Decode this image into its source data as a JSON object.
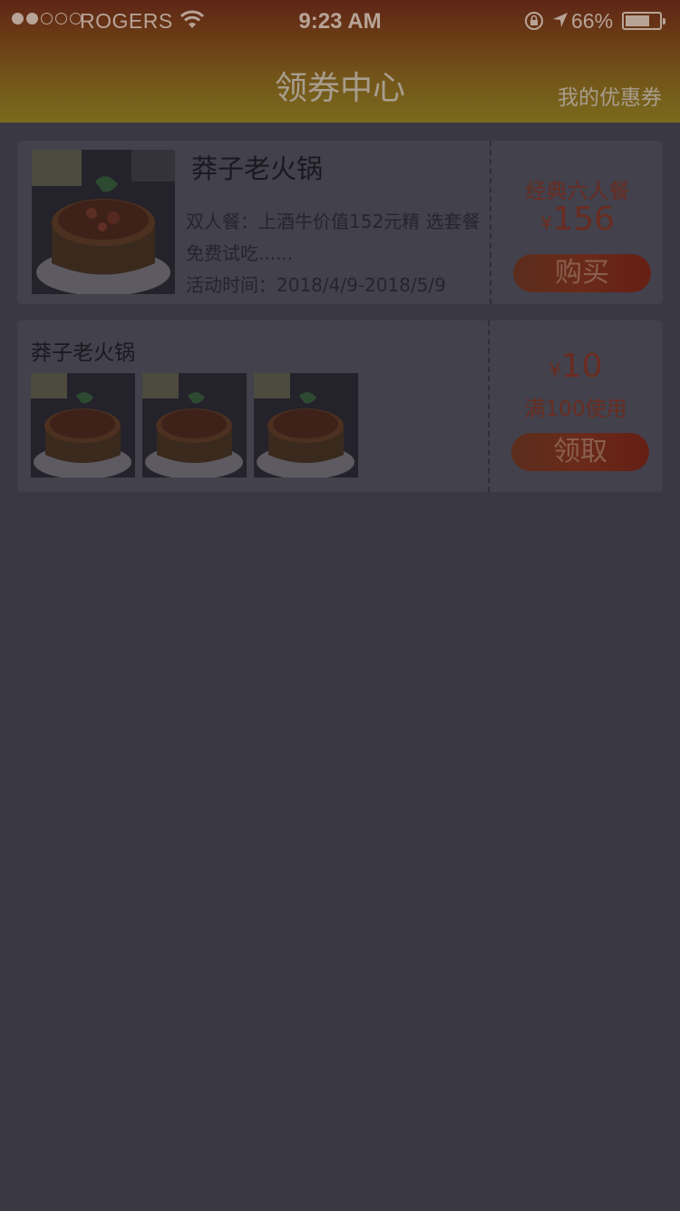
{
  "status_bar": {
    "carrier": "ROGERS",
    "time": "9:23 AM",
    "battery_percent": "66%",
    "signal_dots_filled": 2,
    "signal_dots_total": 5
  },
  "nav": {
    "title": "领券中心",
    "right_link": "我的优惠券"
  },
  "coupons": [
    {
      "shop_name": "莽子老火锅",
      "description_line1": "双人餐：上酒牛价值152元精  选套餐",
      "description_line2": "免费试吃......",
      "activity_time": "活动时间：2018/4/9-2018/5/9",
      "package_name": "经典六人餐",
      "currency": "¥",
      "price": "156",
      "button_label": "购买"
    },
    {
      "shop_name": "莽子老火锅",
      "currency": "¥",
      "amount": "10",
      "condition": "满100使用",
      "button_label": "领取"
    }
  ],
  "colors": {
    "page_bg": "#393843",
    "card_bg": "#42414c",
    "accent": "#6a2c20",
    "header_top": "#5e2517",
    "header_bottom": "#7a6a1c"
  }
}
